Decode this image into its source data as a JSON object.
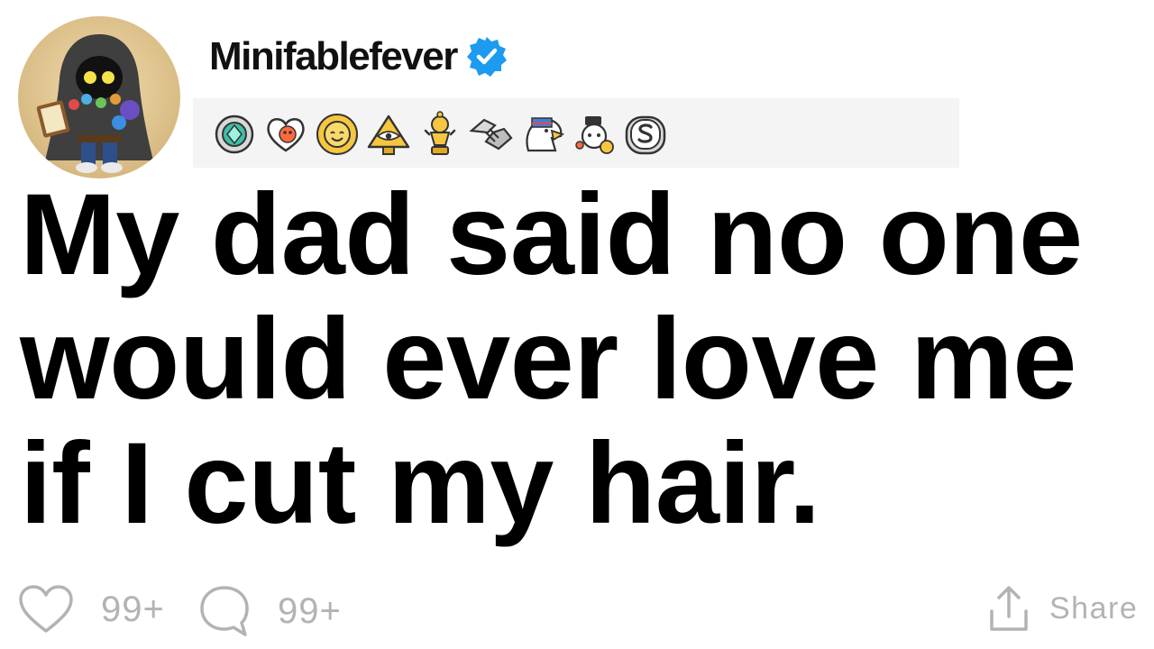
{
  "post": {
    "username": "Minifablefever",
    "verified_icon": "verified-badge-icon",
    "title_lines": [
      "My dad said no one",
      "would ever love me",
      "if I cut my hair."
    ]
  },
  "awards": [
    "platinum-gem-award-icon",
    "heart-snoo-award-icon",
    "smiling-sun-award-icon",
    "pyramid-eye-award-icon",
    "trophy-snoo-award-icon",
    "handshake-award-icon",
    "eagle-award-icon",
    "snoo-hat-award-icon",
    "silver-coin-award-icon"
  ],
  "actions": {
    "likes_count": "99+",
    "comments_count": "99+",
    "share_label": "Share"
  },
  "colors": {
    "verified_blue": "#1d9bf0",
    "muted_gray": "#b3b3b3",
    "award_bar_bg": "#f4f4f4"
  }
}
